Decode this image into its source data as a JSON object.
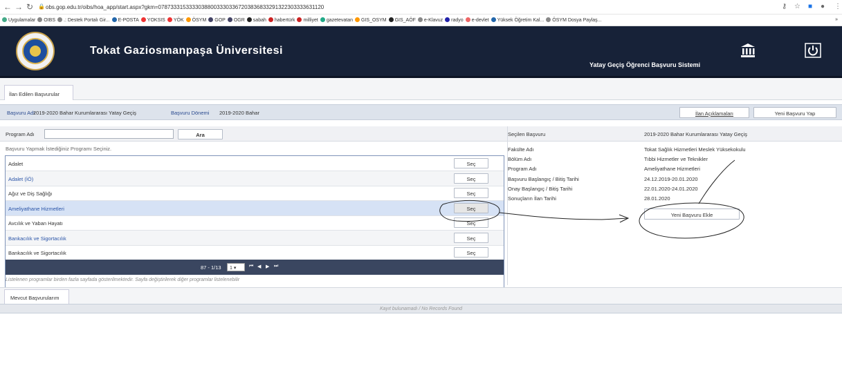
{
  "browser": {
    "url": "obs.gop.edu.tr/oibs/hoa_app/start.aspx?gkm=078733315333303880033303367203836833291322303333631120",
    "bookmarks": [
      "Uygulamalar",
      "OIBS",
      ".: Destek Portalı Gir...",
      "E-POSTA",
      "YOKSIS",
      "YÖK",
      "ÖSYM",
      "GOP",
      "OGR",
      "sabah",
      "habertürk",
      "milliyet",
      "gazetevatan",
      "GIS_OSYM",
      "GIS_AÖF",
      "e-Klavuz",
      "radyo",
      "e-devlet",
      "Yüksek Öğretim Kal...",
      "ÖSYM Dosya Paylaş..."
    ],
    "more_label": "»"
  },
  "header": {
    "university": "Tokat Gaziosmanpaşa Üniversitesi",
    "system": "Yatay Geçiş Öğrenci Başvuru Sistemi"
  },
  "tabs": {
    "top": "İlan Edilen Başvurular",
    "bottom": "Mevcut Başvurularım"
  },
  "filter": {
    "basvuru_adi_label": "Başvuru Adı",
    "basvuru_adi_value": "2019-2020 Bahar Kurumlararası Yatay Geçiş",
    "donem_label": "Başvuru Dönemi",
    "donem_value": "2019-2020 Bahar",
    "ilan_button": "İlan Açıklamaları",
    "new_button": "Yeni Başvuru Yap"
  },
  "search": {
    "label": "Program Adı",
    "value": "",
    "button": "Ara",
    "hint": "Başvuru Yapmak İstediğiniz Programı Seçiniz."
  },
  "programs": [
    {
      "name": "Adalet",
      "button": "Seç"
    },
    {
      "name": "Adalet (İÖ)",
      "button": "Seç"
    },
    {
      "name": "Ağız ve Diş Sağlığı",
      "button": "Seç"
    },
    {
      "name": "Ameliyathane Hizmetleri",
      "button": "Seç"
    },
    {
      "name": "Avcılık ve Yaban Hayatı",
      "button": "Seç"
    },
    {
      "name": "Bankacılık ve Sigortacılık",
      "button": "Seç"
    },
    {
      "name": "Bankacılık ve Sigortacılık",
      "button": "Seç"
    }
  ],
  "pager": {
    "range": "87 - 1/13",
    "page": "1"
  },
  "note": "Listelenen programlar birden fazla sayfada gösterilmektedir. Sayfa değiştirilerek diğer programlar listelenebilir",
  "selected": {
    "header_label": "Seçilen Başvuru",
    "header_value": "2019-2020 Bahar Kurumlararası Yatay Geçiş",
    "rows": [
      {
        "label": "Fakülte Adı",
        "value": "Tokat Sağlık Hizmetleri Meslek Yüksekokulu"
      },
      {
        "label": "Bölüm Adı",
        "value": "Tıbbi Hizmetler ve Teknikler"
      },
      {
        "label": "Program Adı",
        "value": "Ameliyathane Hizmetleri"
      },
      {
        "label": "Başvuru Başlangıç / Bitiş Tarihi",
        "value": "24.12.2019-20.01.2020"
      },
      {
        "label": "Onay Başlangıç / Bitiş Tarihi",
        "value": "22.01.2020-24.01.2020"
      },
      {
        "label": "Sonuçların İlan Tarihi",
        "value": "28.01.2020"
      }
    ],
    "add_button": "Yeni Başvuru Ekle"
  },
  "records_empty": "Kayıt bulunamadı / No Records Found"
}
